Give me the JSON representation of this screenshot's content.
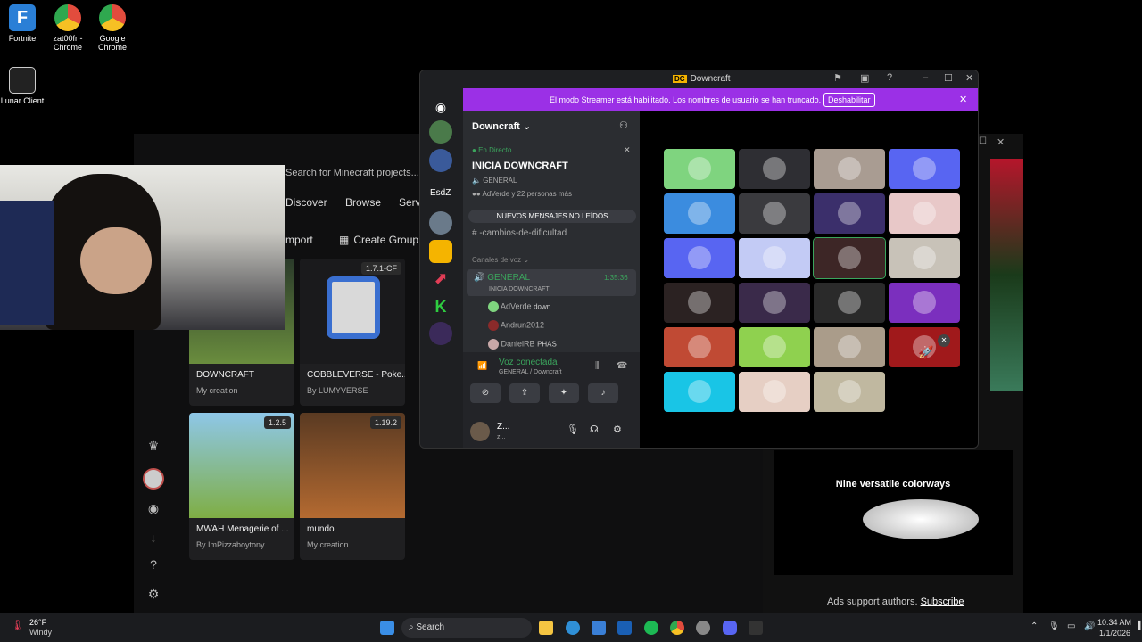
{
  "desktop": {
    "icons": [
      {
        "label": "Fortnite",
        "color": "#2a7fd6"
      },
      {
        "label": "zat00fr - Chrome",
        "color": "#e24c3d"
      },
      {
        "label": "Google Chrome",
        "color": "#e24c3d"
      },
      {
        "label": "Lunar Client",
        "color": "#222222"
      }
    ]
  },
  "curseforge": {
    "search_placeholder": "Search for Minecraft projects...",
    "nav": [
      "Discover",
      "Browse",
      "Serv"
    ],
    "import_label": "mport",
    "create_group_label": "Create Group",
    "cards": [
      {
        "title": "DOWNCRAFT",
        "subtitle": "My creation",
        "badge": "",
        "color": "#6a8d3e"
      },
      {
        "title": "COBBLEVERSE - Poke...",
        "subtitle": "By LUMYVERSE",
        "badge": "1.7.1-CF",
        "color": "#d9d9d9"
      },
      {
        "title": "MWAH Menagerie of ...",
        "subtitle": "By ImPizzaboytony",
        "badge": "1.2.5",
        "color": "#7fae44"
      },
      {
        "title": "mundo",
        "subtitle": "My creation",
        "badge": "1.19.2",
        "color": "#b46a31"
      }
    ]
  },
  "right_window": {
    "promo_text": "Nine versatile colorways",
    "ads_text": "Ads support authors.",
    "subscribe_link": "Subscribe"
  },
  "discord": {
    "window_title": "Downcraft",
    "banner_text": "El modo Streamer está habilitado. Los nombres de usuario se han truncado.",
    "banner_button": "Deshabilitar",
    "server_name": "Downcraft",
    "live_label": "En Directo",
    "event_title": "INICIA DOWNCRAFT",
    "event_channel": "GENERAL",
    "event_people": "AdVerde y 22 personas más",
    "unread_label": "NUEVOS MENSAJES NO LEÍDOS",
    "text_channel": "-cambios-de-dificultad",
    "voice_category": "Canales de voz",
    "voice_channel": "GENERAL",
    "voice_timer": "1:35:36",
    "voice_subtitle": "INICIA DOWNCRAFT",
    "voice_users": [
      {
        "name": "AdVerde",
        "status": "down"
      },
      {
        "name": "Andrun2012",
        "status": ""
      },
      {
        "name": "DanielRB",
        "status": "PHAS"
      }
    ],
    "voice_connected": "Voz conectada",
    "voice_connected_sub": "GENERAL / Downcraft",
    "user_name": "Z...",
    "user_sub": "z...",
    "guild_label": "EsdZ",
    "tile_colors": [
      "#7fd47f",
      "#2e2e33",
      "#a99c92",
      "#5865f2",
      "#3b8cdf",
      "#3a3a3e",
      "#3b2f6b",
      "#e8c8c8",
      "#5865f2",
      "#c3cbf5",
      "#3d2626",
      "#c8c2b8",
      "#2b2222",
      "#3a2a4a",
      "#2a2a2a",
      "#7b2fbe",
      "#c04a34",
      "#8fd14f",
      "#aa9c8a",
      "#a0191b",
      "#19c5e6",
      "#e6cfc4",
      "#c0b8a0",
      "#0b0b0b"
    ]
  },
  "taskbar": {
    "weather_temp": "26°F",
    "weather_desc": "Windy",
    "search_label": "Search",
    "time": "10:34 AM",
    "date": "1/1/2026"
  }
}
